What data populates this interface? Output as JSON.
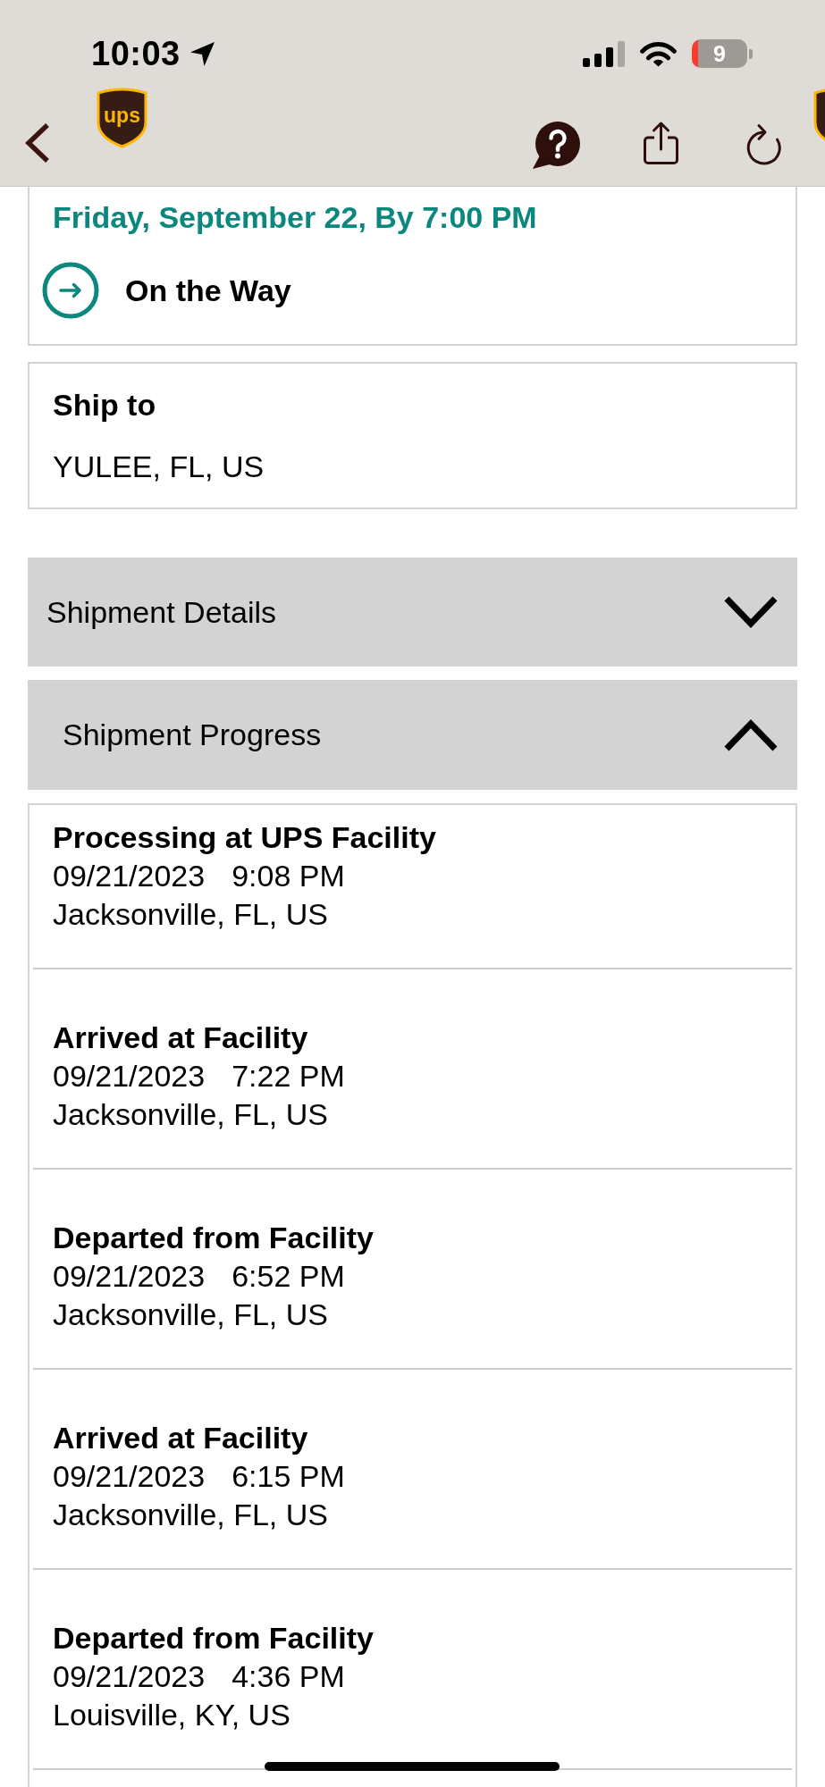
{
  "status_bar": {
    "time": "10:03",
    "battery": "9"
  },
  "header": {
    "logo_text": "ups"
  },
  "delivery": {
    "date": "Friday, September 22, By 7:00 PM",
    "status": "On the Way"
  },
  "ship_to": {
    "label": "Ship to",
    "address": "YULEE, FL, US"
  },
  "sections": [
    {
      "title": "Shipment Details",
      "expanded": false
    },
    {
      "title": "Shipment Progress",
      "expanded": true,
      "events": [
        {
          "title": "Processing at UPS Facility",
          "date": "09/21/2023",
          "time": "9:08 PM",
          "location": "Jacksonville, FL, US"
        },
        {
          "title": "Arrived at Facility",
          "date": "09/21/2023",
          "time": "7:22 PM",
          "location": "Jacksonville, FL, US"
        },
        {
          "title": "Departed from Facility",
          "date": "09/21/2023",
          "time": "6:52 PM",
          "location": "Jacksonville, FL, US"
        },
        {
          "title": "Arrived at Facility",
          "date": "09/21/2023",
          "time": "6:15 PM",
          "location": "Jacksonville, FL, US"
        },
        {
          "title": "Departed from Facility",
          "date": "09/21/2023",
          "time": "4:36 PM",
          "location": "Louisville, KY, US"
        }
      ]
    }
  ]
}
